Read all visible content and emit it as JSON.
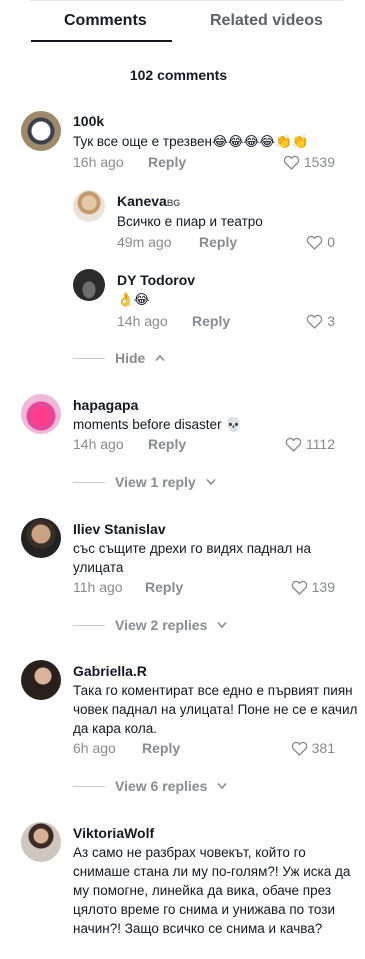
{
  "tabs": {
    "comments": "Comments",
    "related": "Related videos"
  },
  "count_label": "102 comments",
  "comments": [
    {
      "user": "100k",
      "text": "Тук все още е трезвен",
      "emoji": "😂😂😂😂👏👏",
      "time": "16h ago",
      "reply": "Reply",
      "likes": "1539"
    },
    {
      "user": "Kaneva",
      "tag": "BG",
      "text": "Всичко е пиар и театро",
      "time": "49m ago",
      "reply": "Reply",
      "likes": "0"
    },
    {
      "user": "DY Todorov",
      "emoji": "👌😂",
      "time": "14h ago",
      "reply": "Reply",
      "likes": "3"
    },
    {
      "user": "hapagapa",
      "text": "moments before disaster",
      "emoji": "💀",
      "time": "14h ago",
      "reply": "Reply",
      "likes": "1112"
    },
    {
      "user": "Iliev Stanislav",
      "text": "със същите дрехи го видях паднал на улицата",
      "time": "11h ago",
      "reply": "Reply",
      "likes": "139"
    },
    {
      "user": "Gabriella.R",
      "text": "Така го коментират все едно е първият пиян човек паднал на улицата! Поне не се е качил да кара кола.",
      "time": "6h ago",
      "reply": "Reply",
      "likes": "381"
    },
    {
      "user": "ViktoriaWolf",
      "text": "Аз само не разбрах човекът, който го снимаше стана ли му по-голям?! Уж иска да му помогне, линейка да вика, обаче през цялото време го снима и унижава по този начин?! Защо всичко се снима и качва?"
    }
  ],
  "threads": {
    "hide": "Hide",
    "view1": "View 1 reply",
    "view2": "View 2 replies",
    "view6": "View 6 replies"
  },
  "icons": {
    "heart": "heart-outline-icon",
    "chev_up": "chevron-up-icon",
    "chev_down": "chevron-down-icon"
  }
}
